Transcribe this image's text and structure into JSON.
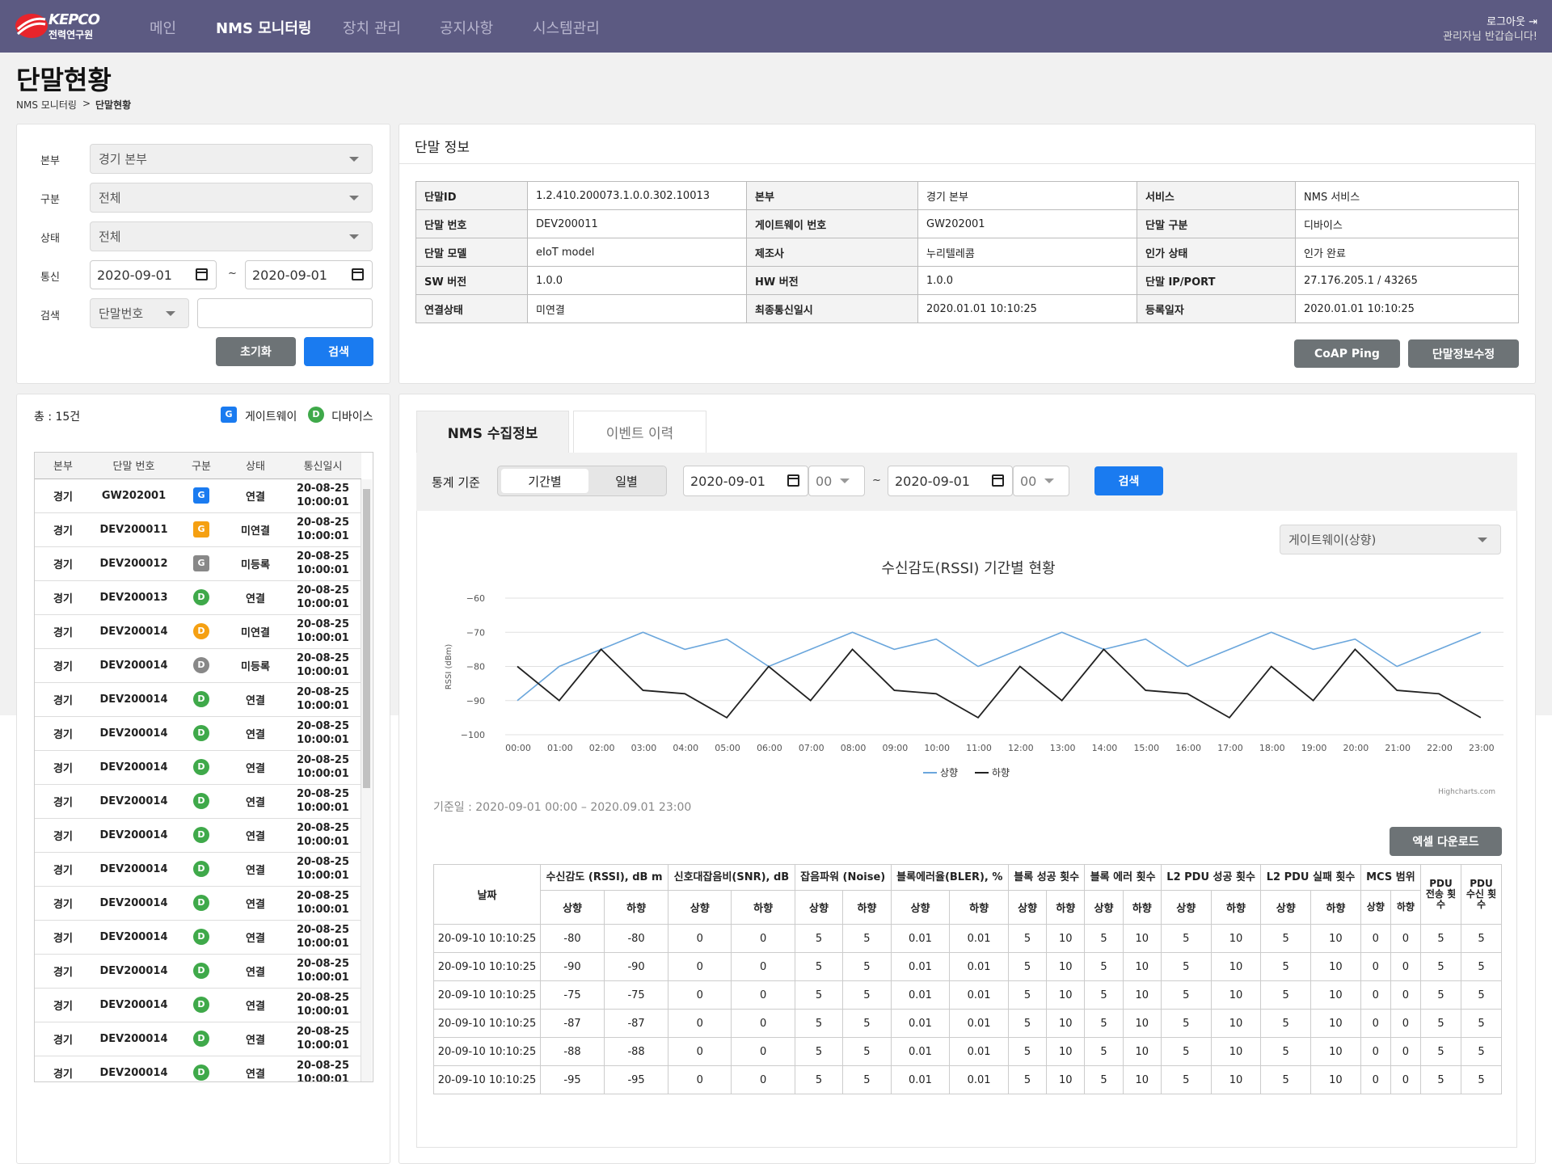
{
  "header": {
    "logo_text": "KEPCO",
    "logo_sub": "전력연구원",
    "nav": [
      "메인",
      "NMS 모니터링",
      "장치 관리",
      "공지사항",
      "시스템관리"
    ],
    "logout": "로그아웃",
    "welcome": "관리자님 반갑습니다!"
  },
  "page": {
    "title": "단말현황",
    "crumb_parent": "NMS 모니터링",
    "crumb_sep": ">",
    "crumb_current": "단말현황"
  },
  "filter": {
    "labels": [
      "본부",
      "구분",
      "상태",
      "통신",
      "검색"
    ],
    "hq": "경기 본부",
    "type": "전체",
    "status": "전체",
    "date_from": "2020-09-01",
    "date_to": "2020-09-01",
    "tilde": "~",
    "search_field": "단말번호",
    "search_value": "",
    "reset": "초기화",
    "search": "검색"
  },
  "list": {
    "total": "총 : 15건",
    "legend_g": "게이트웨이",
    "legend_d": "디바이스",
    "legend_g_letter": "G",
    "legend_d_letter": "D",
    "headers": [
      "본부",
      "단말 번호",
      "구분",
      "상태",
      "통신일시"
    ],
    "rows": [
      [
        "경기",
        "GW202001",
        "G",
        "연결",
        "20-08-25",
        "10:00:01"
      ],
      [
        "경기",
        "DEV200011",
        "G",
        "미연결",
        "20-08-25",
        "10:00:01"
      ],
      [
        "경기",
        "DEV200012",
        "G",
        "미등록",
        "20-08-25",
        "10:00:01"
      ],
      [
        "경기",
        "DEV200013",
        "D",
        "연결",
        "20-08-25",
        "10:00:01"
      ],
      [
        "경기",
        "DEV200014",
        "D",
        "미연결",
        "20-08-25",
        "10:00:01"
      ],
      [
        "경기",
        "DEV200014",
        "D",
        "미등록",
        "20-08-25",
        "10:00:01"
      ],
      [
        "경기",
        "DEV200014",
        "D",
        "연결",
        "20-08-25",
        "10:00:01"
      ],
      [
        "경기",
        "DEV200014",
        "D",
        "연결",
        "20-08-25",
        "10:00:01"
      ],
      [
        "경기",
        "DEV200014",
        "D",
        "연결",
        "20-08-25",
        "10:00:01"
      ],
      [
        "경기",
        "DEV200014",
        "D",
        "연결",
        "20-08-25",
        "10:00:01"
      ],
      [
        "경기",
        "DEV200014",
        "D",
        "연결",
        "20-08-25",
        "10:00:01"
      ],
      [
        "경기",
        "DEV200014",
        "D",
        "연결",
        "20-08-25",
        "10:00:01"
      ],
      [
        "경기",
        "DEV200014",
        "D",
        "연결",
        "20-08-25",
        "10:00:01"
      ],
      [
        "경기",
        "DEV200014",
        "D",
        "연결",
        "20-08-25",
        "10:00:01"
      ],
      [
        "경기",
        "DEV200014",
        "D",
        "연결",
        "20-08-25",
        "10:00:01"
      ],
      [
        "경기",
        "DEV200014",
        "D",
        "연결",
        "20-08-25",
        "10:00:01"
      ],
      [
        "경기",
        "DEV200014",
        "D",
        "연결",
        "20-08-25",
        "10:00:01"
      ],
      [
        "경기",
        "DEV200014",
        "D",
        "연결",
        "20-08-25",
        "10:00:01"
      ]
    ]
  },
  "badge_colors": {
    "연결": "#3fa94a",
    "미연결": "#f5a012",
    "미등록": "#888888"
  },
  "info": {
    "title": "단말 정보",
    "rows": [
      [
        "단말ID",
        "1.2.410.200073.1.0.0.302.10013",
        "본부",
        "경기 본부",
        "서비스",
        "NMS 서비스"
      ],
      [
        "단말 번호",
        "DEV200011",
        "게이트웨이 번호",
        "GW202001",
        "단말 구분",
        "디바이스"
      ],
      [
        "단말 모델",
        "eIoT model",
        "제조사",
        "누리텔레콤",
        "인가 상태",
        "인가 완료"
      ],
      [
        "SW 버전",
        "1.0.0",
        "HW 버전",
        "1.0.0",
        "단말 IP/PORT",
        "27.176.205.1 / 43265"
      ],
      [
        "연결상태",
        "미연결",
        "최종통신일시",
        "2020.01.01 10:10:25",
        "등록일자",
        "2020.01.01 10:10:25"
      ]
    ],
    "btn_ping": "CoAP Ping",
    "btn_edit": "단말정보수정"
  },
  "nms": {
    "tab1": "NMS 수집정보",
    "tab2": "이벤트 이력",
    "stat_label": "통계 기준",
    "seg1": "기간별",
    "seg2": "일별",
    "date_from": "2020-09-01",
    "hour_from": "00",
    "tilde": "~",
    "date_to": "2020-09-01",
    "hour_to": "00",
    "search": "검색",
    "chart_select": "게이트웨이(상향)",
    "basis": "기준일 : 2020-09-01 00:00 – 2020.09.01 23:00",
    "excel": "엑셀 다운로드",
    "credit": "Highcharts.com"
  },
  "chart_data": {
    "type": "line",
    "title": "수신감도(RSSI) 기간별 현황",
    "ylabel": "RSSI (dBm)",
    "ylim": [
      -100,
      -60
    ],
    "yticks": [
      -60,
      -70,
      -80,
      -90,
      -100
    ],
    "categories": [
      "00:00",
      "01:00",
      "02:00",
      "03:00",
      "04:00",
      "05:00",
      "06:00",
      "07:00",
      "08:00",
      "09:00",
      "10:00",
      "11:00",
      "12:00",
      "13:00",
      "14:00",
      "15:00",
      "16:00",
      "17:00",
      "18:00",
      "19:00",
      "20:00",
      "21:00",
      "22:00",
      "23:00"
    ],
    "series": [
      {
        "name": "상향",
        "color": "#6aa6dc",
        "values": [
          -90,
          -80,
          -75,
          -70,
          -75,
          -72,
          -80,
          -75,
          -70,
          -75,
          -72,
          -80,
          -75,
          -70,
          -75,
          -72,
          -80,
          -75,
          -70,
          -75,
          -72,
          -80,
          -75,
          -70
        ]
      },
      {
        "name": "하향",
        "color": "#222222",
        "values": [
          -80,
          -90,
          -75,
          -87,
          -88,
          -95,
          -80,
          -90,
          -75,
          -87,
          -88,
          -95,
          -80,
          -90,
          -75,
          -87,
          -88,
          -95,
          -80,
          -90,
          -75,
          -87,
          -88,
          -95
        ]
      }
    ]
  },
  "stat": {
    "date_header": "날짜",
    "groups": [
      "수신감도 (RSSI), dB m",
      "신호대잡음비(SNR), dB",
      "잡음파워 (Noise)",
      "블록에러율(BLER), %",
      "블록 성공 횟수",
      "블록 에러 횟수",
      "L2 PDU 성공 횟수",
      "L2 PDU 실패 횟수",
      "MCS 범위",
      "PDU 전송 횟수",
      "PDU 수신 횟수"
    ],
    "up": "상향",
    "down": "하향",
    "rows": [
      [
        "20-09-10 10:10:25",
        "-80",
        "-80",
        "0",
        "0",
        "5",
        "5",
        "0.01",
        "0.01",
        "5",
        "10",
        "5",
        "10",
        "5",
        "10",
        "5",
        "10",
        "0",
        "0",
        "5",
        "5"
      ],
      [
        "20-09-10 10:10:25",
        "-90",
        "-90",
        "0",
        "0",
        "5",
        "5",
        "0.01",
        "0.01",
        "5",
        "10",
        "5",
        "10",
        "5",
        "10",
        "5",
        "10",
        "0",
        "0",
        "5",
        "5"
      ],
      [
        "20-09-10 10:10:25",
        "-75",
        "-75",
        "0",
        "0",
        "5",
        "5",
        "0.01",
        "0.01",
        "5",
        "10",
        "5",
        "10",
        "5",
        "10",
        "5",
        "10",
        "0",
        "0",
        "5",
        "5"
      ],
      [
        "20-09-10 10:10:25",
        "-87",
        "-87",
        "0",
        "0",
        "5",
        "5",
        "0.01",
        "0.01",
        "5",
        "10",
        "5",
        "10",
        "5",
        "10",
        "5",
        "10",
        "0",
        "0",
        "5",
        "5"
      ],
      [
        "20-09-10 10:10:25",
        "-88",
        "-88",
        "0",
        "0",
        "5",
        "5",
        "0.01",
        "0.01",
        "5",
        "10",
        "5",
        "10",
        "5",
        "10",
        "5",
        "10",
        "0",
        "0",
        "5",
        "5"
      ],
      [
        "20-09-10 10:10:25",
        "-95",
        "-95",
        "0",
        "0",
        "5",
        "5",
        "0.01",
        "0.01",
        "5",
        "10",
        "5",
        "10",
        "5",
        "10",
        "5",
        "10",
        "0",
        "0",
        "5",
        "5"
      ]
    ]
  }
}
